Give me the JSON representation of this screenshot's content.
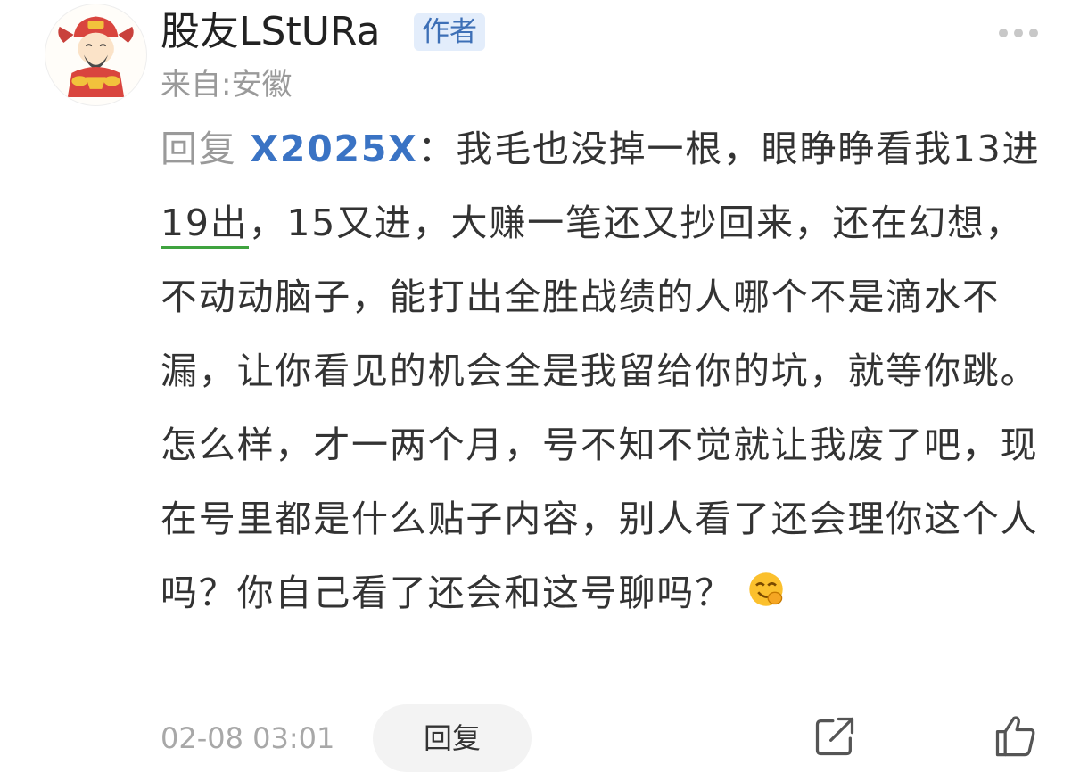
{
  "comment": {
    "username": "股友LStURa",
    "badge": "作者",
    "location": "来自:安徽",
    "reply_prefix": "回复",
    "mention": "X2025X",
    "text_part1": "：我毛也没掉一根，眼睁睁看我13进",
    "underlined_text": "19出",
    "text_part2": "，15又进，大赚一笔还又抄回来，还在幻想，不动动脑子，能打出全胜战绩的人哪个不是滴水不漏，让你看见的机会全是我留给你的坑，就等你跳。怎么样，才一两个月，号不知不觉就让我废了吧，现在号里都是什么贴子内容，别人看了还会理你这个人吗？你自己看了还会和这号聊吗？",
    "timestamp": "02-08 03:01",
    "reply_button": "回复",
    "icons": {
      "avatar": "god-of-wealth-avatar",
      "more": "more-dots-icon",
      "emoji": "smirk-emoji-icon",
      "share": "share-icon",
      "like": "thumbs-up-icon"
    },
    "colors": {
      "mention": "#3a73c4",
      "badge_bg": "#e3edfb",
      "badge_text": "#3d6fb6",
      "underline": "#3fa33f"
    }
  }
}
